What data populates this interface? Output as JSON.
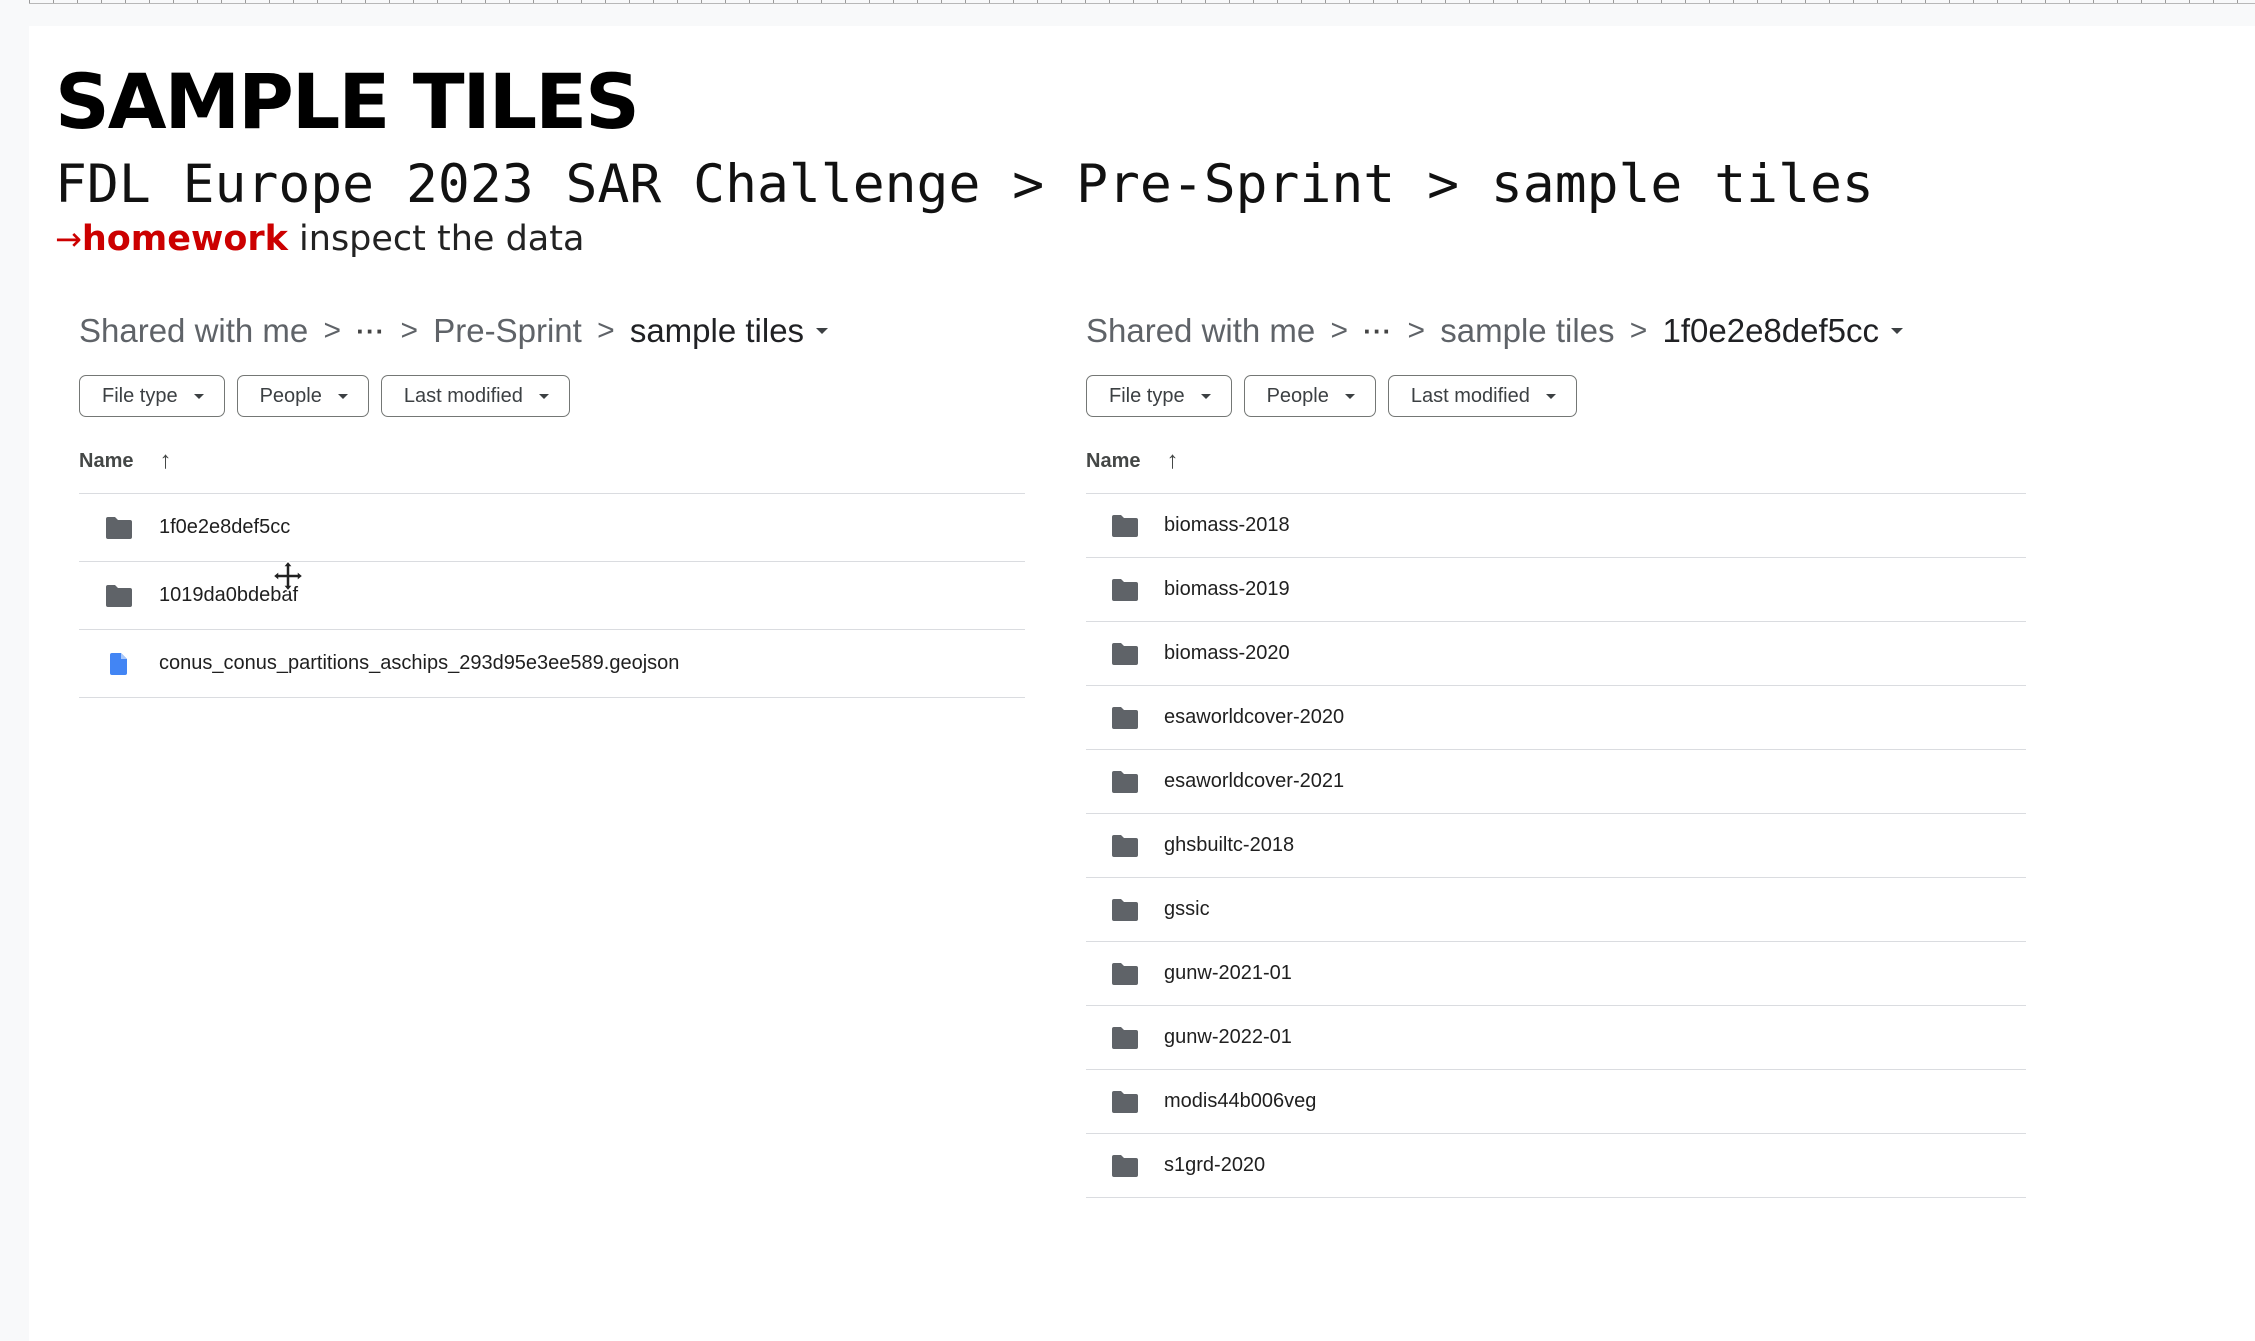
{
  "slide": {
    "title": "SAMPLE TILES",
    "path_line": "FDL Europe 2023 SAR Challenge > Pre-Sprint > sample tiles",
    "homework_arrow": "→",
    "homework_word": "homework",
    "homework_text": " inspect the data"
  },
  "colors": {
    "accent_red": "#cc0000",
    "folder_icon": "#5f6368",
    "file_icon": "#4285f4"
  },
  "left_panel": {
    "breadcrumb": {
      "root": "Shared with me",
      "sep": ">",
      "ellipsis": "···",
      "parent": "Pre-Sprint",
      "current": "sample tiles"
    },
    "filters": {
      "file_type": "File type",
      "people": "People",
      "last_modified": "Last modified"
    },
    "column_name": "Name",
    "sort_arrow": "↑",
    "items": [
      {
        "name": "1f0e2e8def5cc",
        "icon": "folder-icon"
      },
      {
        "name": "1019da0bdebaf",
        "icon": "folder-icon"
      },
      {
        "name": "conus_conus_partitions_aschips_293d95e3ee589.geojson",
        "icon": "file-icon"
      }
    ]
  },
  "right_panel": {
    "breadcrumb": {
      "root": "Shared with me",
      "sep": ">",
      "ellipsis": "···",
      "parent": "sample tiles",
      "current": "1f0e2e8def5cc"
    },
    "filters": {
      "file_type": "File type",
      "people": "People",
      "last_modified": "Last modified"
    },
    "column_name": "Name",
    "sort_arrow": "↑",
    "items": [
      {
        "name": "biomass-2018",
        "icon": "folder-icon"
      },
      {
        "name": "biomass-2019",
        "icon": "folder-icon"
      },
      {
        "name": "biomass-2020",
        "icon": "folder-icon"
      },
      {
        "name": "esaworldcover-2020",
        "icon": "folder-icon"
      },
      {
        "name": "esaworldcover-2021",
        "icon": "folder-icon"
      },
      {
        "name": "ghsbuiltc-2018",
        "icon": "folder-icon"
      },
      {
        "name": "gssic",
        "icon": "folder-icon"
      },
      {
        "name": "gunw-2021-01",
        "icon": "folder-icon"
      },
      {
        "name": "gunw-2022-01",
        "icon": "folder-icon"
      },
      {
        "name": "modis44b006veg",
        "icon": "folder-icon"
      },
      {
        "name": "s1grd-2020",
        "icon": "folder-icon"
      }
    ]
  }
}
